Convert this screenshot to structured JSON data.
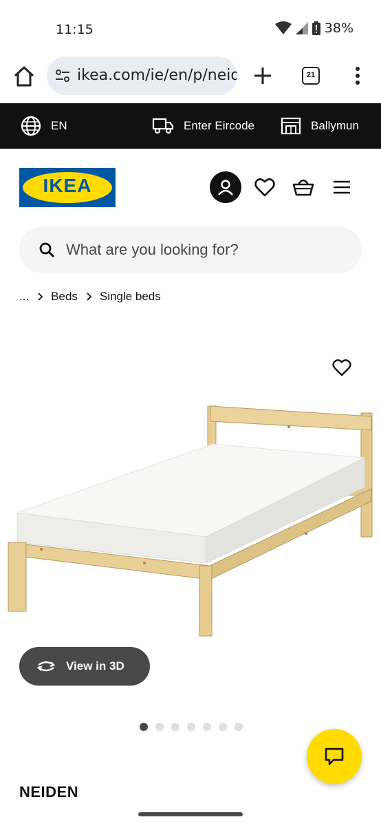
{
  "status_bar": {
    "time": "11:15",
    "battery_text": "38%",
    "icons": [
      "wifi-icon",
      "signal-icon",
      "battery-alert-icon"
    ]
  },
  "browser": {
    "url": "ikea.com/ie/en/p/neide",
    "tab_count": "21",
    "icons": [
      "home-icon",
      "site-settings-icon",
      "new-tab-icon",
      "tab-switcher-icon",
      "overflow-menu-icon"
    ]
  },
  "top_bar": {
    "language": "EN",
    "eircode": "Enter Eircode",
    "store": "Ballymun"
  },
  "header": {
    "logo_text": "IKEA",
    "icons": [
      "account-icon",
      "heart-icon",
      "basket-icon",
      "hamburger-menu-icon"
    ]
  },
  "search": {
    "placeholder": "What are you looking for?"
  },
  "breadcrumb": {
    "ellipsis": "...",
    "items": [
      "Beds",
      "Single beds"
    ]
  },
  "product": {
    "view_3d_label": "View in 3D",
    "carousel_count": 7,
    "carousel_active": 0,
    "title": "NEIDEN"
  },
  "colors": {
    "ikea_blue": "#0058a3",
    "ikea_yellow": "#ffdb00",
    "top_bar_bg": "#111111",
    "view3d_bg": "#484848"
  }
}
